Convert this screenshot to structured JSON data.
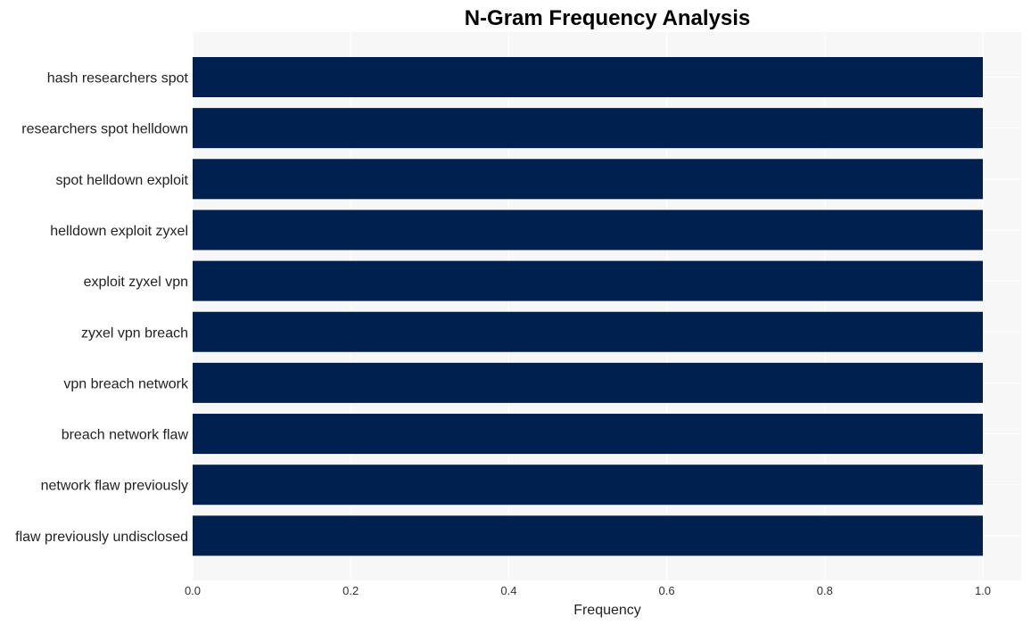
{
  "chart_data": {
    "type": "bar",
    "orientation": "horizontal",
    "title": "N-Gram Frequency Analysis",
    "xlabel": "Frequency",
    "ylabel": "",
    "xlim": [
      0,
      1.05
    ],
    "xticks": [
      "0.0",
      "0.2",
      "0.4",
      "0.6",
      "0.8",
      "1.0"
    ],
    "grid": true,
    "legend": "none",
    "bar_color": "#00214f",
    "background_color": "#f7f7f7",
    "categories": [
      "hash researchers spot",
      "researchers spot helldown",
      "spot helldown exploit",
      "helldown exploit zyxel",
      "exploit zyxel vpn",
      "zyxel vpn breach",
      "vpn breach network",
      "breach network flaw",
      "network flaw previously",
      "flaw previously undisclosed"
    ],
    "values": [
      1,
      1,
      1,
      1,
      1,
      1,
      1,
      1,
      1,
      1
    ]
  }
}
